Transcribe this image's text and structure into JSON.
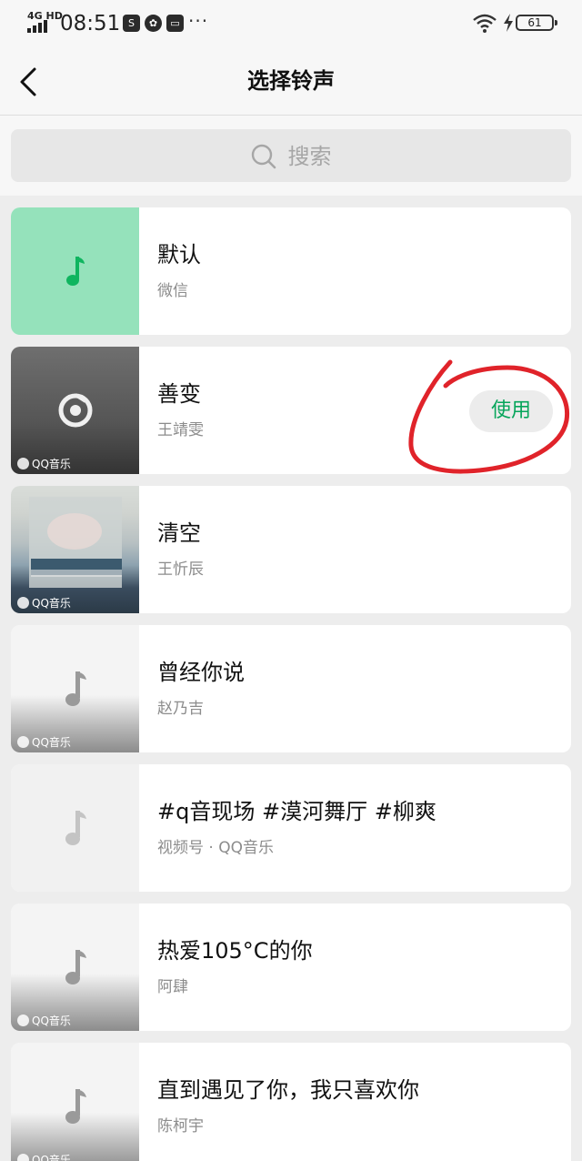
{
  "status_bar": {
    "network": "4G HD",
    "time": "08:51",
    "notification_icons": [
      "sim-icon",
      "wechat-icon",
      "message-icon"
    ],
    "more": "···",
    "battery": "61",
    "icons": [
      "wifi-icon",
      "charging-icon",
      "battery-icon"
    ]
  },
  "nav": {
    "title": "选择铃声",
    "back_icon": "chevron-left-icon"
  },
  "search": {
    "placeholder": "搜索",
    "icon": "search-icon"
  },
  "colors": {
    "accent": "#07a55b",
    "annotation": "#e0232a",
    "default_thumb": "#95e2bb"
  },
  "ringtones": [
    {
      "title": "默认",
      "subtitle": "微信",
      "source_badge": ""
    },
    {
      "title": "善变",
      "subtitle": "王靖雯",
      "source_badge": "QQ音乐",
      "action": "使用"
    },
    {
      "title": "清空",
      "subtitle": "王忻辰",
      "source_badge": "QQ音乐"
    },
    {
      "title": "曾经你说",
      "subtitle": "赵乃吉",
      "source_badge": "QQ音乐"
    },
    {
      "title": "#q音现场 #漠河舞厅 #柳爽",
      "subtitle": "视频号 · QQ音乐",
      "source_badge": ""
    },
    {
      "title": "热爱105°C的你",
      "subtitle": "阿肆",
      "source_badge": "QQ音乐"
    },
    {
      "title": "直到遇见了你，我只喜欢你",
      "subtitle": "陈柯宇",
      "source_badge": "QQ音乐"
    }
  ]
}
